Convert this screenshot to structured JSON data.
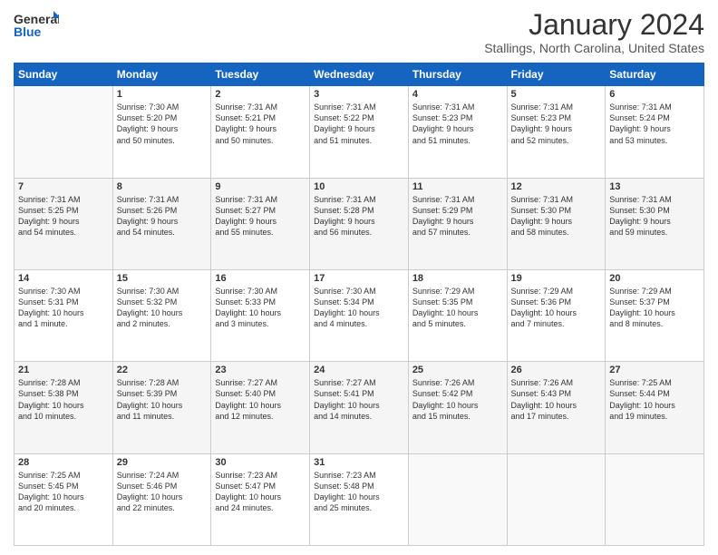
{
  "logo": {
    "line1": "General",
    "line2": "Blue"
  },
  "title": "January 2024",
  "location": "Stallings, North Carolina, United States",
  "headers": [
    "Sunday",
    "Monday",
    "Tuesday",
    "Wednesday",
    "Thursday",
    "Friday",
    "Saturday"
  ],
  "weeks": [
    [
      {
        "day": "",
        "info": ""
      },
      {
        "day": "1",
        "info": "Sunrise: 7:30 AM\nSunset: 5:20 PM\nDaylight: 9 hours\nand 50 minutes."
      },
      {
        "day": "2",
        "info": "Sunrise: 7:31 AM\nSunset: 5:21 PM\nDaylight: 9 hours\nand 50 minutes."
      },
      {
        "day": "3",
        "info": "Sunrise: 7:31 AM\nSunset: 5:22 PM\nDaylight: 9 hours\nand 51 minutes."
      },
      {
        "day": "4",
        "info": "Sunrise: 7:31 AM\nSunset: 5:23 PM\nDaylight: 9 hours\nand 51 minutes."
      },
      {
        "day": "5",
        "info": "Sunrise: 7:31 AM\nSunset: 5:23 PM\nDaylight: 9 hours\nand 52 minutes."
      },
      {
        "day": "6",
        "info": "Sunrise: 7:31 AM\nSunset: 5:24 PM\nDaylight: 9 hours\nand 53 minutes."
      }
    ],
    [
      {
        "day": "7",
        "info": "Sunrise: 7:31 AM\nSunset: 5:25 PM\nDaylight: 9 hours\nand 54 minutes."
      },
      {
        "day": "8",
        "info": "Sunrise: 7:31 AM\nSunset: 5:26 PM\nDaylight: 9 hours\nand 54 minutes."
      },
      {
        "day": "9",
        "info": "Sunrise: 7:31 AM\nSunset: 5:27 PM\nDaylight: 9 hours\nand 55 minutes."
      },
      {
        "day": "10",
        "info": "Sunrise: 7:31 AM\nSunset: 5:28 PM\nDaylight: 9 hours\nand 56 minutes."
      },
      {
        "day": "11",
        "info": "Sunrise: 7:31 AM\nSunset: 5:29 PM\nDaylight: 9 hours\nand 57 minutes."
      },
      {
        "day": "12",
        "info": "Sunrise: 7:31 AM\nSunset: 5:30 PM\nDaylight: 9 hours\nand 58 minutes."
      },
      {
        "day": "13",
        "info": "Sunrise: 7:31 AM\nSunset: 5:30 PM\nDaylight: 9 hours\nand 59 minutes."
      }
    ],
    [
      {
        "day": "14",
        "info": "Sunrise: 7:30 AM\nSunset: 5:31 PM\nDaylight: 10 hours\nand 1 minute."
      },
      {
        "day": "15",
        "info": "Sunrise: 7:30 AM\nSunset: 5:32 PM\nDaylight: 10 hours\nand 2 minutes."
      },
      {
        "day": "16",
        "info": "Sunrise: 7:30 AM\nSunset: 5:33 PM\nDaylight: 10 hours\nand 3 minutes."
      },
      {
        "day": "17",
        "info": "Sunrise: 7:30 AM\nSunset: 5:34 PM\nDaylight: 10 hours\nand 4 minutes."
      },
      {
        "day": "18",
        "info": "Sunrise: 7:29 AM\nSunset: 5:35 PM\nDaylight: 10 hours\nand 5 minutes."
      },
      {
        "day": "19",
        "info": "Sunrise: 7:29 AM\nSunset: 5:36 PM\nDaylight: 10 hours\nand 7 minutes."
      },
      {
        "day": "20",
        "info": "Sunrise: 7:29 AM\nSunset: 5:37 PM\nDaylight: 10 hours\nand 8 minutes."
      }
    ],
    [
      {
        "day": "21",
        "info": "Sunrise: 7:28 AM\nSunset: 5:38 PM\nDaylight: 10 hours\nand 10 minutes."
      },
      {
        "day": "22",
        "info": "Sunrise: 7:28 AM\nSunset: 5:39 PM\nDaylight: 10 hours\nand 11 minutes."
      },
      {
        "day": "23",
        "info": "Sunrise: 7:27 AM\nSunset: 5:40 PM\nDaylight: 10 hours\nand 12 minutes."
      },
      {
        "day": "24",
        "info": "Sunrise: 7:27 AM\nSunset: 5:41 PM\nDaylight: 10 hours\nand 14 minutes."
      },
      {
        "day": "25",
        "info": "Sunrise: 7:26 AM\nSunset: 5:42 PM\nDaylight: 10 hours\nand 15 minutes."
      },
      {
        "day": "26",
        "info": "Sunrise: 7:26 AM\nSunset: 5:43 PM\nDaylight: 10 hours\nand 17 minutes."
      },
      {
        "day": "27",
        "info": "Sunrise: 7:25 AM\nSunset: 5:44 PM\nDaylight: 10 hours\nand 19 minutes."
      }
    ],
    [
      {
        "day": "28",
        "info": "Sunrise: 7:25 AM\nSunset: 5:45 PM\nDaylight: 10 hours\nand 20 minutes."
      },
      {
        "day": "29",
        "info": "Sunrise: 7:24 AM\nSunset: 5:46 PM\nDaylight: 10 hours\nand 22 minutes."
      },
      {
        "day": "30",
        "info": "Sunrise: 7:23 AM\nSunset: 5:47 PM\nDaylight: 10 hours\nand 24 minutes."
      },
      {
        "day": "31",
        "info": "Sunrise: 7:23 AM\nSunset: 5:48 PM\nDaylight: 10 hours\nand 25 minutes."
      },
      {
        "day": "",
        "info": ""
      },
      {
        "day": "",
        "info": ""
      },
      {
        "day": "",
        "info": ""
      }
    ]
  ]
}
